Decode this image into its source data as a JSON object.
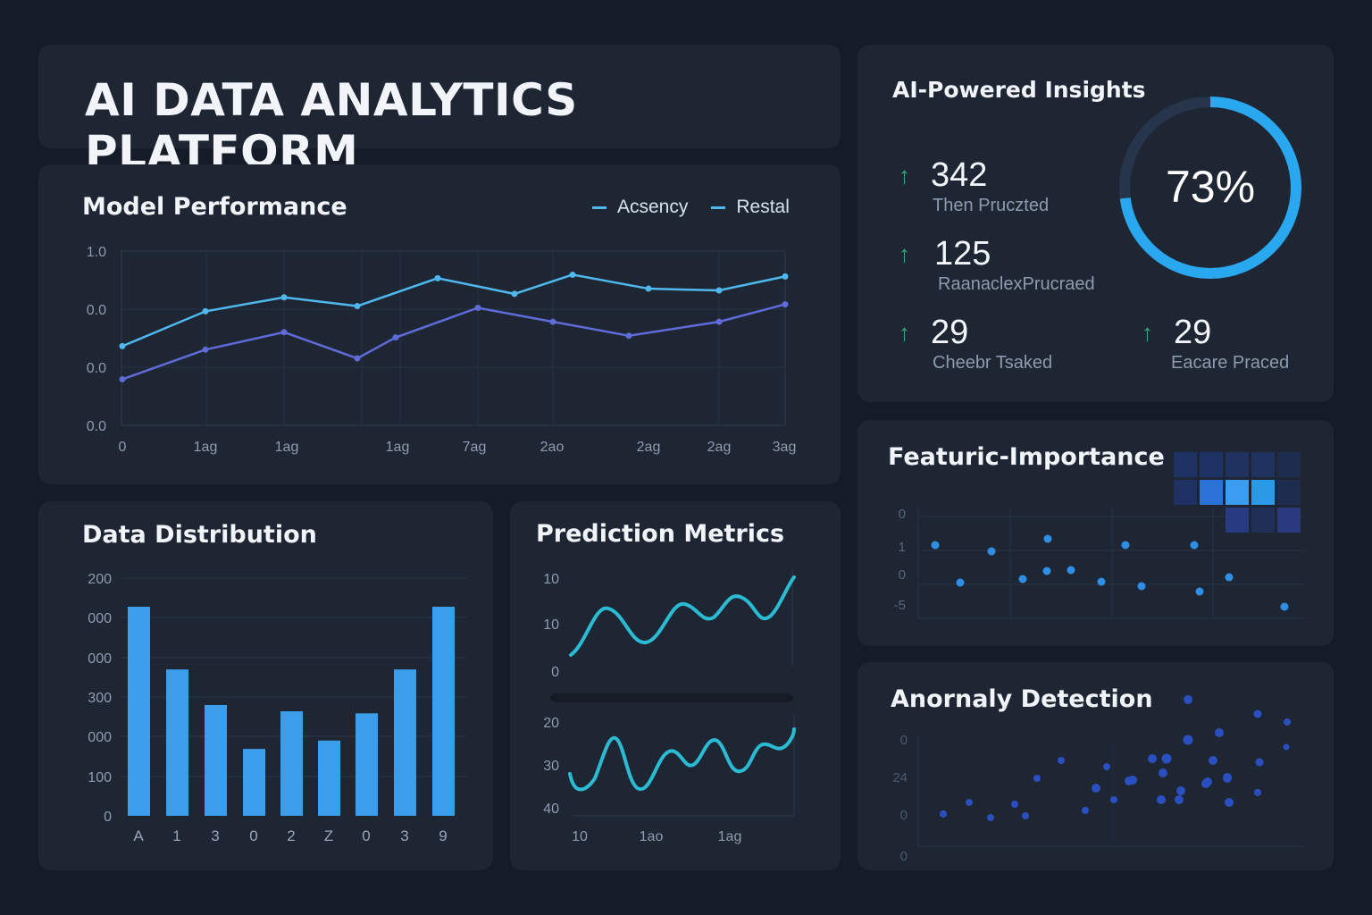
{
  "header": {
    "title": "AI DATA ANALYTICS PLATFORM"
  },
  "colors": {
    "background": "#161c27",
    "panel": "#1e2634",
    "line_primary": "#4fb8ee",
    "line_secondary": "#5e6bd8",
    "bar": "#3a9eea",
    "wave": "#2bbcd4",
    "ring": "#2aa8ef",
    "arrow": "#3fa586",
    "heatmap_bright": "#2a7ee0"
  },
  "model_performance": {
    "title": "Model Performance",
    "legend": [
      {
        "label": "Acsency"
      },
      {
        "label": "Restal"
      }
    ],
    "chart_data": {
      "type": "line",
      "x": [
        "0",
        "1ag",
        "1ag",
        "",
        "1ag",
        "7ag",
        "2ao",
        "",
        "2ag",
        "2ag",
        "3ag"
      ],
      "y_tick_labels": [
        "1.0",
        "0.0",
        "0.0",
        "0.0"
      ],
      "series": [
        {
          "name": "Acsency",
          "values": [
            0.48,
            0.68,
            0.76,
            0.71,
            0.87,
            0.78,
            0.89,
            0.81,
            0.8,
            0.88
          ]
        },
        {
          "name": "Restal",
          "values": [
            0.29,
            0.46,
            0.56,
            0.41,
            0.53,
            0.7,
            0.62,
            0.54,
            0.62,
            0.72
          ]
        }
      ],
      "ylim": [
        0,
        1
      ]
    }
  },
  "insights": {
    "title": "AI-Powered Insights",
    "stats": [
      {
        "value": "342",
        "label": "Then Pruczted"
      },
      {
        "value": "125",
        "label": "RaanaclexPrucraed"
      },
      {
        "value": "29",
        "label": "Cheebr Tsaked"
      },
      {
        "value": "29",
        "label": "Eacare Praced"
      }
    ],
    "gauge": {
      "label": "73%",
      "value": 0.73
    }
  },
  "data_distribution": {
    "title": "Data Distribution",
    "chart_data": {
      "type": "bar",
      "categories": [
        "A",
        "1",
        "3",
        "0",
        "2",
        "Z",
        "0",
        "3",
        "9"
      ],
      "y_tick_labels": [
        "200",
        "000",
        "000",
        "300",
        "000",
        "100",
        "0"
      ],
      "values": [
        1.0,
        0.7,
        0.53,
        0.32,
        0.5,
        0.36,
        0.49,
        0.7,
        1.0
      ]
    }
  },
  "prediction_metrics": {
    "title": "Prediction Metrics",
    "charts": [
      {
        "chart_data": {
          "type": "line",
          "y_tick_labels": [
            "10",
            "10",
            "0"
          ],
          "x_tick_labels": []
        }
      },
      {
        "chart_data": {
          "type": "line",
          "y_tick_labels": [
            "20",
            "30",
            "40"
          ],
          "x_tick_labels": [
            "10",
            "1ao",
            "1ag"
          ]
        }
      }
    ]
  },
  "feature_importance": {
    "title": "Featuric-Importance",
    "y_tick_labels": [
      "0",
      "1",
      "0",
      "-5"
    ],
    "chart_data": {
      "type": "scatter"
    }
  },
  "anomaly_detection": {
    "title": "Anornaly Detection",
    "y_tick_labels": [
      "0",
      "24",
      "0",
      "0"
    ],
    "chart_data": {
      "type": "scatter"
    }
  }
}
